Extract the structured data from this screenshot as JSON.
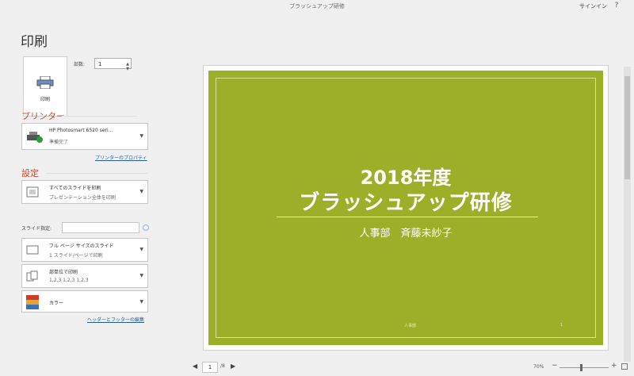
{
  "window": {
    "title": "ブラッシュアップ研修",
    "signin": "サインイン",
    "help": "?"
  },
  "page_title": "印刷",
  "print_button": {
    "label": "印刷"
  },
  "copies": {
    "label": "部数:",
    "value": "1"
  },
  "printer": {
    "heading": "プリンター",
    "name": "HP Photosmart 6520 seri...",
    "status": "準備完了",
    "properties_link": "プリンターのプロパティ"
  },
  "settings": {
    "heading": "設定",
    "range": {
      "line1": "すべてのスライドを印刷",
      "line2": "プレゼンテーション全体を印刷"
    },
    "slides_label": "スライド指定:",
    "layout": {
      "line1": "フル ページ サイズのスライド",
      "line2": "1 スライド/ページで印刷"
    },
    "collate": {
      "line1": "部単位で印刷",
      "line2": "1,2,3  1,2,3  1,2,3"
    },
    "color": {
      "line1": "カラー"
    },
    "header_footer_link": "ヘッダーとフッターの編集"
  },
  "slide": {
    "title_line1": "2018年度",
    "title_line2": "ブラッシュアップ研修",
    "subtitle": "人事部　斉藤未紗子",
    "footer": "人事部",
    "page_number": "1"
  },
  "navigation": {
    "current_page": "1",
    "total_pages": "/8"
  },
  "zoom": {
    "label": "70%"
  },
  "colors": {
    "accent": "#c94a2c",
    "slide_bg": "#9caf28",
    "link": "#2b5d9c"
  }
}
